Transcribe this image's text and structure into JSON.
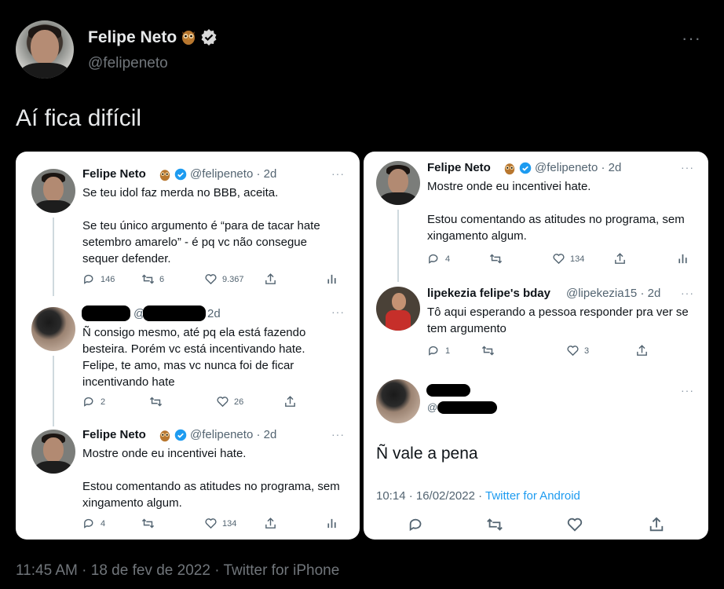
{
  "author": {
    "name": "Felipe Neto",
    "handle": "@felipeneto"
  },
  "tweet": {
    "text": "Aí fica difícil",
    "more": "···"
  },
  "footer": {
    "time": "11:45 AM",
    "date": "18 de fev de 2022",
    "source": "Twitter for iPhone",
    "sep": "·"
  },
  "left_panel": {
    "t1": {
      "name": "Felipe Neto",
      "handle": "@felipeneto · 2d",
      "text": "Se teu idol faz merda no BBB, aceita.\n\nSe teu único argumento é “para de tacar hate setembro amarelo” - é pq vc não consegue sequer defender.",
      "replies": "146",
      "retweets": "6",
      "likes": "9.367"
    },
    "t2": {
      "handle_partial": "@",
      "time": "2d",
      "text": "Ñ consigo mesmo, até pq ela está fazendo besteira. Porém vc está incentivando hate. Felipe, te amo, mas vc nunca foi de ficar incentivando hate",
      "replies": "2",
      "likes": "26"
    },
    "t3": {
      "name": "Felipe Neto",
      "handle": "@felipeneto · 2d",
      "text": "Mostre onde eu incentivei hate.\n\nEstou comentando as atitudes no programa, sem xingamento algum.",
      "replies": "4",
      "likes": "134"
    }
  },
  "right_panel": {
    "t1": {
      "name": "Felipe Neto",
      "handle": "@felipeneto · 2d",
      "text": "Mostre onde eu incentivei hate.\n\nEstou comentando as atitudes no programa, sem xingamento algum.",
      "replies": "4",
      "likes": "134"
    },
    "t2": {
      "name": "lipekezia felipe's bday",
      "handle": "@lipekezia15 · 2d",
      "text": "Tô aqui esperando a pessoa responder pra ver se tem argumento",
      "replies": "1",
      "likes": "3"
    },
    "t3": {
      "handle_partial": "@",
      "text": "Ñ vale a pena",
      "meta_time": "10:14 · 16/02/2022 · ",
      "meta_source": "Twitter for Android"
    }
  },
  "more": "···"
}
